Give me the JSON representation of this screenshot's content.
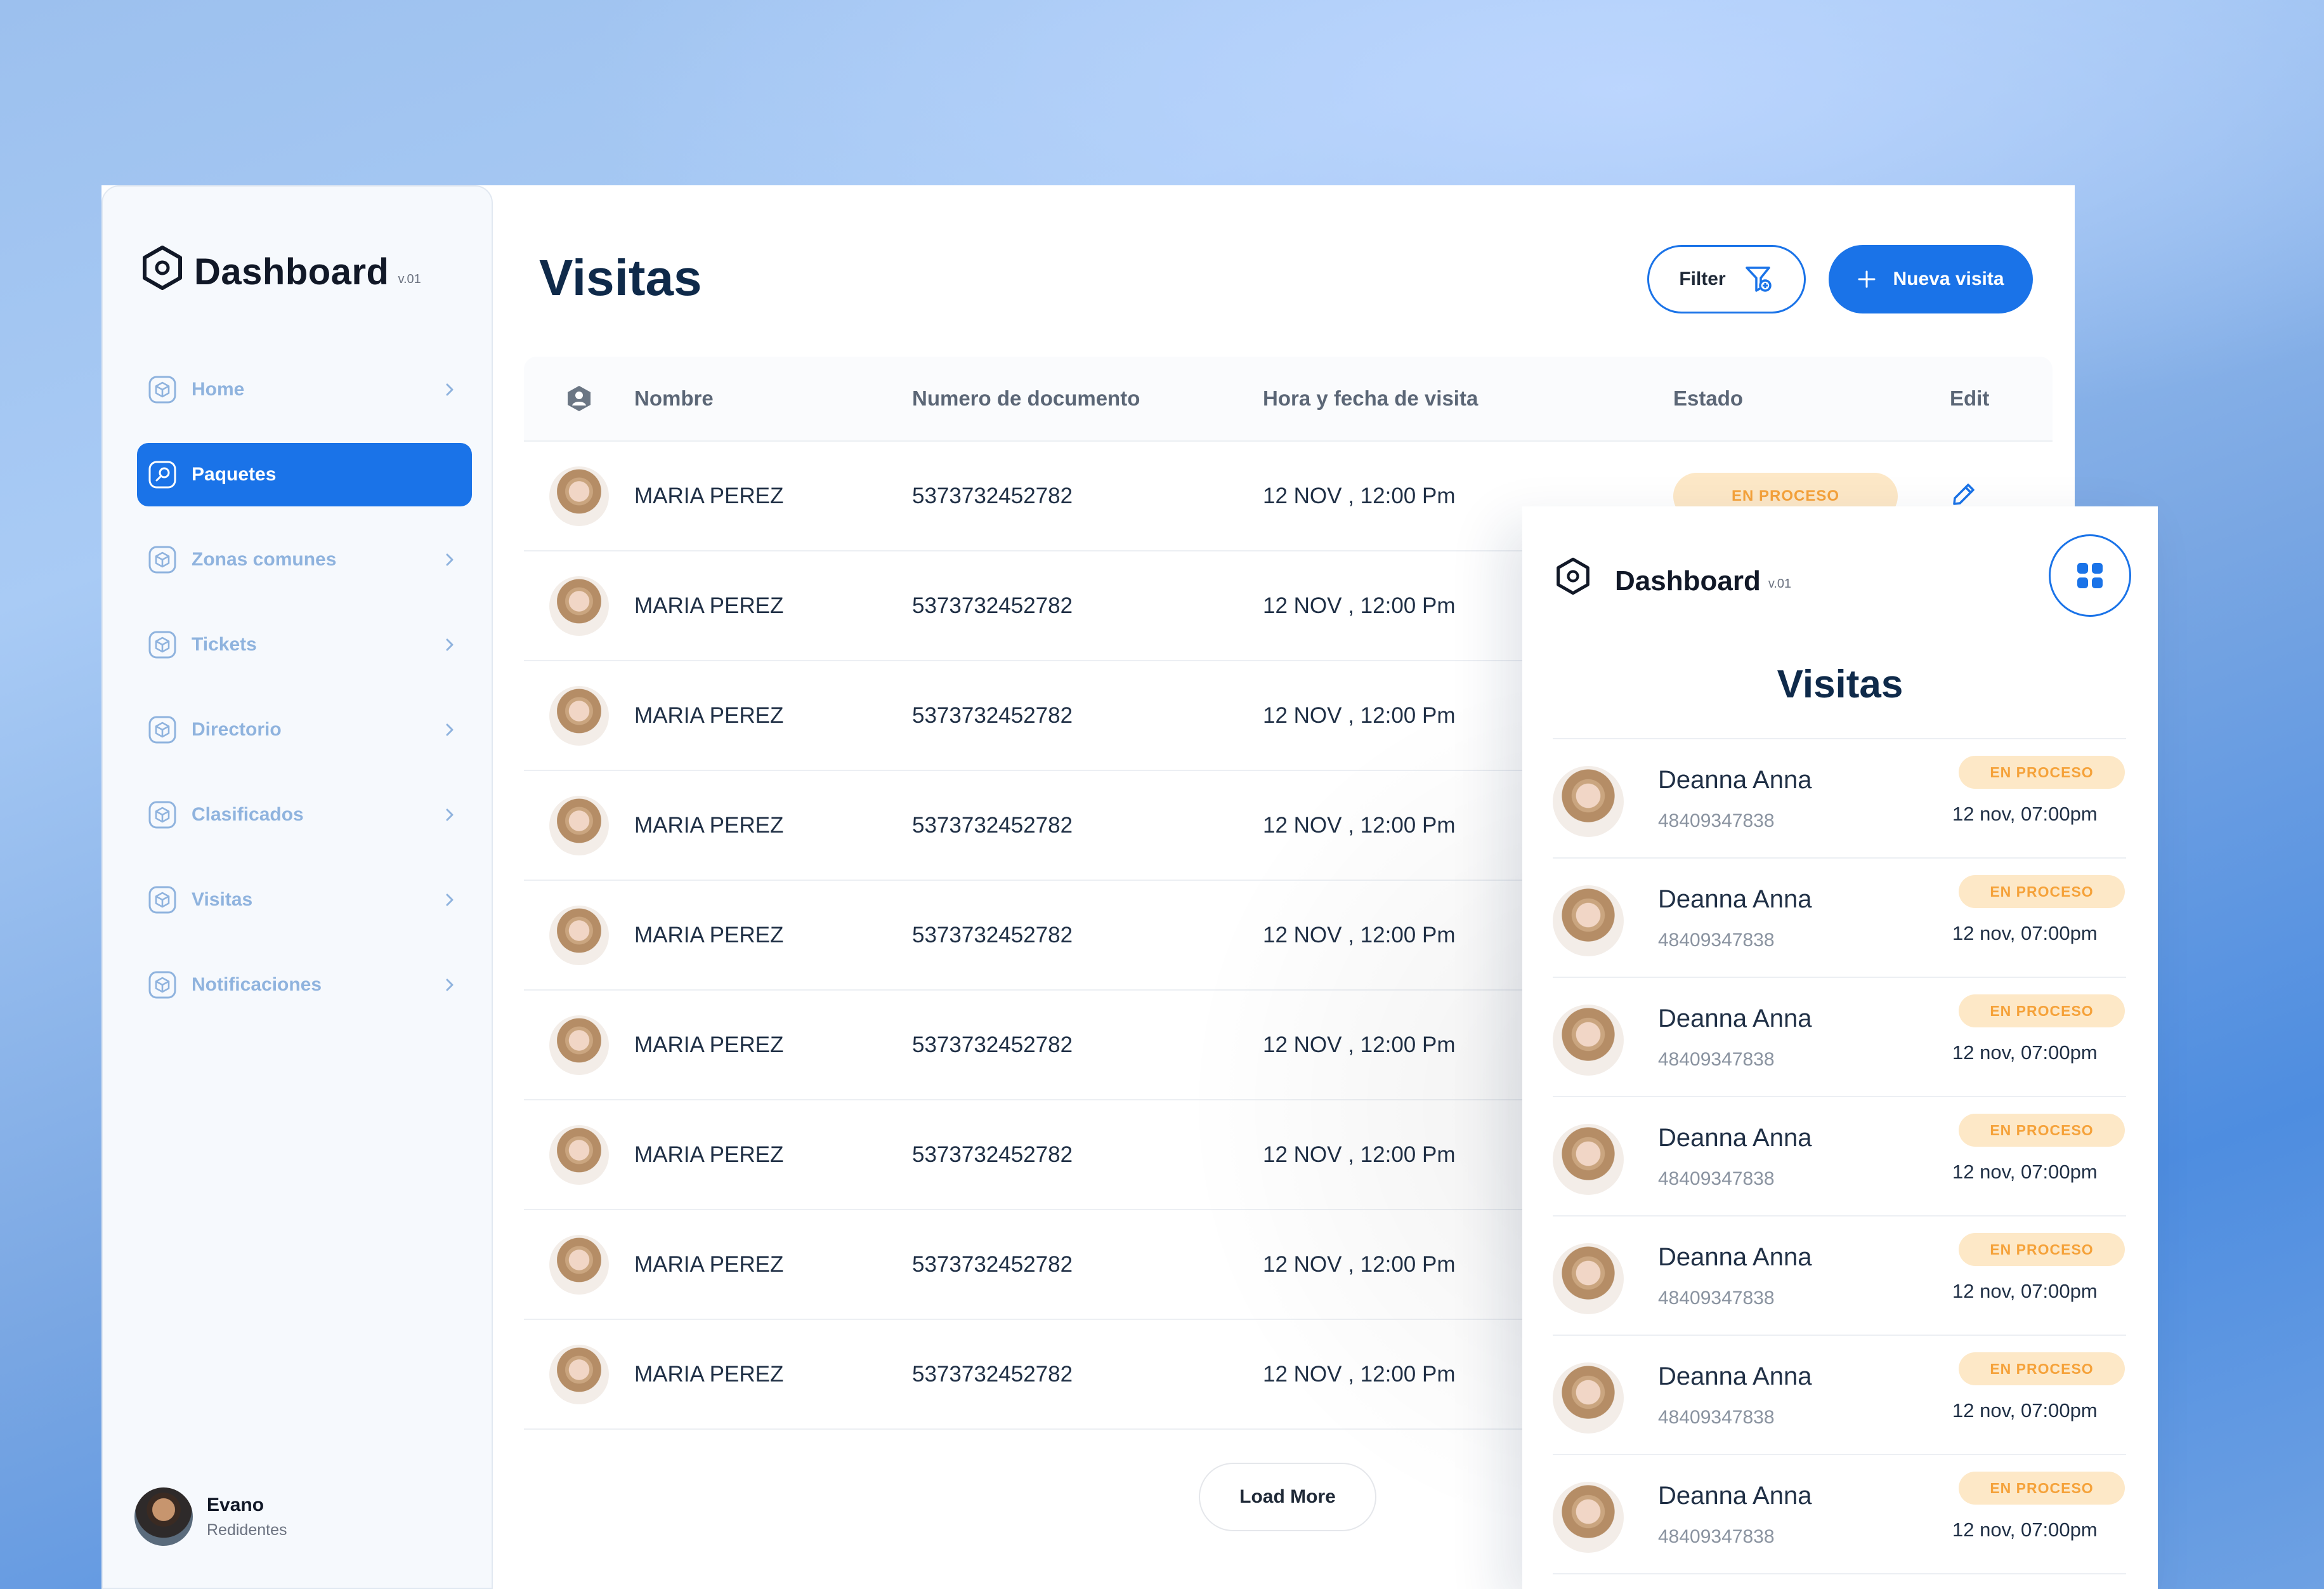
{
  "desktop": {
    "brand": {
      "title": "Dashboard",
      "version": "v.01"
    },
    "sidebar": {
      "items": [
        {
          "label": "Home",
          "active": false
        },
        {
          "label": "Paquetes",
          "active": true
        },
        {
          "label": "Zonas comunes",
          "active": false
        },
        {
          "label": "Tickets",
          "active": false
        },
        {
          "label": "Directorio",
          "active": false
        },
        {
          "label": "Clasificados",
          "active": false
        },
        {
          "label": "Visitas",
          "active": false
        },
        {
          "label": "Notificaciones",
          "active": false
        }
      ]
    },
    "user": {
      "name": "Evano",
      "role": "Redidentes"
    },
    "page_title": "Visitas",
    "filter_label": "Filter",
    "new_label": "Nueva visita",
    "table": {
      "headers": [
        "Nombre",
        "Numero de documento",
        "Hora y fecha de visita",
        "Estado",
        "Edit"
      ],
      "rows": [
        {
          "name": "MARIA PEREZ",
          "doc": "5373732452782",
          "date": "12 NOV , 12:00 Pm",
          "state": "EN PROCESO"
        },
        {
          "name": "MARIA PEREZ",
          "doc": "5373732452782",
          "date": "12 NOV , 12:00 Pm",
          "state": ""
        },
        {
          "name": "MARIA PEREZ",
          "doc": "5373732452782",
          "date": "12 NOV , 12:00 Pm",
          "state": ""
        },
        {
          "name": "MARIA PEREZ",
          "doc": "5373732452782",
          "date": "12 NOV , 12:00 Pm",
          "state": ""
        },
        {
          "name": "MARIA PEREZ",
          "doc": "5373732452782",
          "date": "12 NOV , 12:00 Pm",
          "state": ""
        },
        {
          "name": "MARIA PEREZ",
          "doc": "5373732452782",
          "date": "12 NOV , 12:00 Pm",
          "state": ""
        },
        {
          "name": "MARIA PEREZ",
          "doc": "5373732452782",
          "date": "12 NOV , 12:00 Pm",
          "state": ""
        },
        {
          "name": "MARIA PEREZ",
          "doc": "5373732452782",
          "date": "12 NOV , 12:00 Pm",
          "state": ""
        },
        {
          "name": "MARIA PEREZ",
          "doc": "5373732452782",
          "date": "12 NOV , 12:00 Pm",
          "state": ""
        }
      ]
    },
    "load_more": "Load More"
  },
  "mobile": {
    "brand": {
      "title": "Dashboard",
      "version": "v.01"
    },
    "title": "Visitas",
    "items": [
      {
        "name": "Deanna Anna",
        "doc": "48409347838",
        "state": "EN PROCESO",
        "date": "12 nov, 07:00pm"
      },
      {
        "name": "Deanna Anna",
        "doc": "48409347838",
        "state": "EN PROCESO",
        "date": "12 nov, 07:00pm"
      },
      {
        "name": "Deanna Anna",
        "doc": "48409347838",
        "state": "EN PROCESO",
        "date": "12 nov, 07:00pm"
      },
      {
        "name": "Deanna Anna",
        "doc": "48409347838",
        "state": "EN PROCESO",
        "date": "12 nov, 07:00pm"
      },
      {
        "name": "Deanna Anna",
        "doc": "48409347838",
        "state": "EN PROCESO",
        "date": "12 nov, 07:00pm"
      },
      {
        "name": "Deanna Anna",
        "doc": "48409347838",
        "state": "EN PROCESO",
        "date": "12 nov, 07:00pm"
      },
      {
        "name": "Deanna Anna",
        "doc": "48409347838",
        "state": "EN PROCESO",
        "date": "12 nov, 07:00pm"
      }
    ]
  },
  "colors": {
    "primary": "#1a73e8",
    "title": "#0f2a4a",
    "badge_bg": "#fde8c7",
    "badge_text": "#f5a23a",
    "nav_text": "#8fb3de"
  },
  "icons": {
    "brand": "hexagon-logo-icon",
    "nav": "cube-icon",
    "active_nav": "search-icon",
    "chevron": "chevron-right-icon",
    "filter": "funnel-icon",
    "add": "plus-icon",
    "edit": "pencil-icon",
    "header_user": "user-badge-icon",
    "grid": "grid-icon"
  }
}
